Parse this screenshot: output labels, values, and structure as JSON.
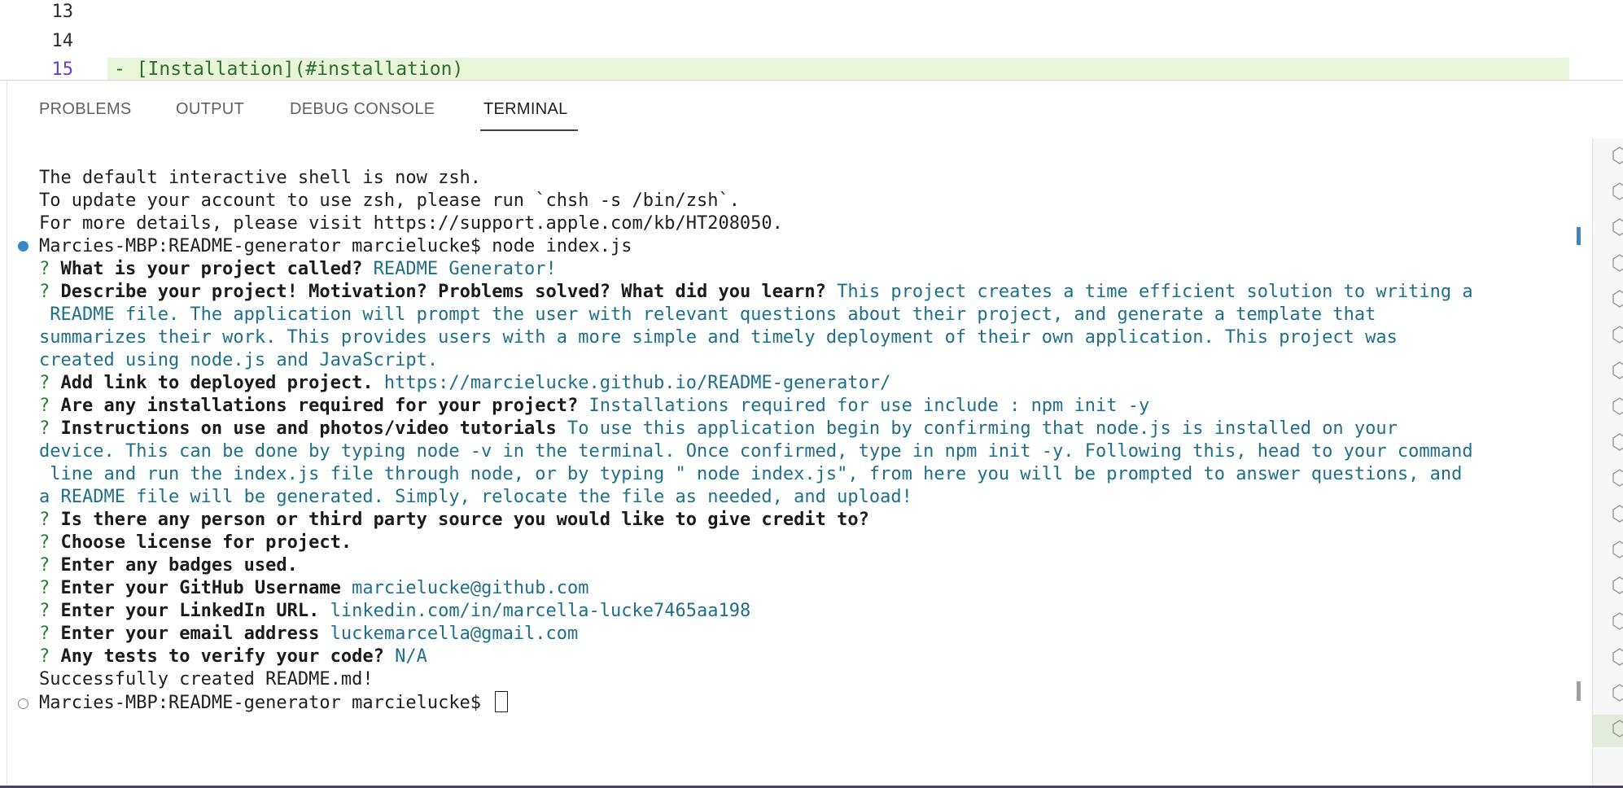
{
  "editor": {
    "lines": [
      {
        "number": "13",
        "content": ""
      },
      {
        "number": "14",
        "content": ""
      },
      {
        "number": "15",
        "dash": "- ",
        "link_text": "[Installation]",
        "link_target": "(#installation)"
      }
    ]
  },
  "panel": {
    "tabs": [
      {
        "label": "PROBLEMS",
        "active": false
      },
      {
        "label": "OUTPUT",
        "active": false
      },
      {
        "label": "DEBUG CONSOLE",
        "active": false
      },
      {
        "label": "TERMINAL",
        "active": true
      }
    ]
  },
  "terminal": {
    "intro": [
      "The default interactive shell is now zsh.",
      "To update your account to use zsh, please run `chsh -s /bin/zsh`.",
      "For more details, please visit https://support.apple.com/kb/HT208050."
    ],
    "command_prompt": "Marcies-MBP:README-generator marcielucke$ ",
    "command": "node index.js",
    "qmark": "?",
    "qa": [
      {
        "question": "What is your project called?",
        "answer_lines": [
          "README Generator!"
        ]
      },
      {
        "question": "Describe your project! Motivation? Problems solved? What did you learn?",
        "answer_lines": [
          "This project creates a time efficient solution to writing a",
          " README file. The application will prompt the user with relevant questions about their project, and generate a template that",
          "summarizes their work. This provides users with a more simple and timely deployment of their own application. This project was",
          "created using node.js and JavaScript."
        ]
      },
      {
        "question": "Add link to deployed project.",
        "answer_lines": [
          "https://marcielucke.github.io/README-generator/"
        ]
      },
      {
        "question": "Are any installations required for your project?",
        "answer_lines": [
          "Installations required for use include : npm init -y"
        ]
      },
      {
        "question": "Instructions on use and photos/video tutorials",
        "answer_lines": [
          "To use this application begin by confirming that node.js is installed on your",
          "device. This can be done by typing node -v in the terminal. Once confirmed, type in npm init -y. Following this, head to your command",
          " line and run the index.js file through node, or by typing \" node index.js\", from here you will be prompted to answer questions, and",
          "a README file will be generated. Simply, relocate the file as needed, and upload!"
        ]
      },
      {
        "question": "Is there any person or third party source you would like to give credit to?",
        "answer_lines": []
      },
      {
        "question": "Choose license for project.",
        "answer_lines": []
      },
      {
        "question": "Enter any badges used.",
        "answer_lines": []
      },
      {
        "question": "Enter your GitHub Username",
        "answer_lines": [
          "marcielucke@github.com"
        ]
      },
      {
        "question": "Enter your LinkedIn URL.",
        "answer_lines": [
          "linkedin.com/in/marcella-lucke7465aa198"
        ]
      },
      {
        "question": "Enter your email address",
        "answer_lines": [
          "luckemarcella@gmail.com"
        ]
      },
      {
        "question": "Any tests to verify your code?",
        "answer_lines": [
          "N/A"
        ]
      }
    ],
    "success": "Successfully created README.md!",
    "final_prompt": "Marcies-MBP:README-generator marcielucke$ "
  },
  "colors": {
    "answer": "#1f6f8b",
    "qmark": "#2e7d32",
    "marker_active": "#3a86c8",
    "line_highlight": "#e8f5d8"
  }
}
